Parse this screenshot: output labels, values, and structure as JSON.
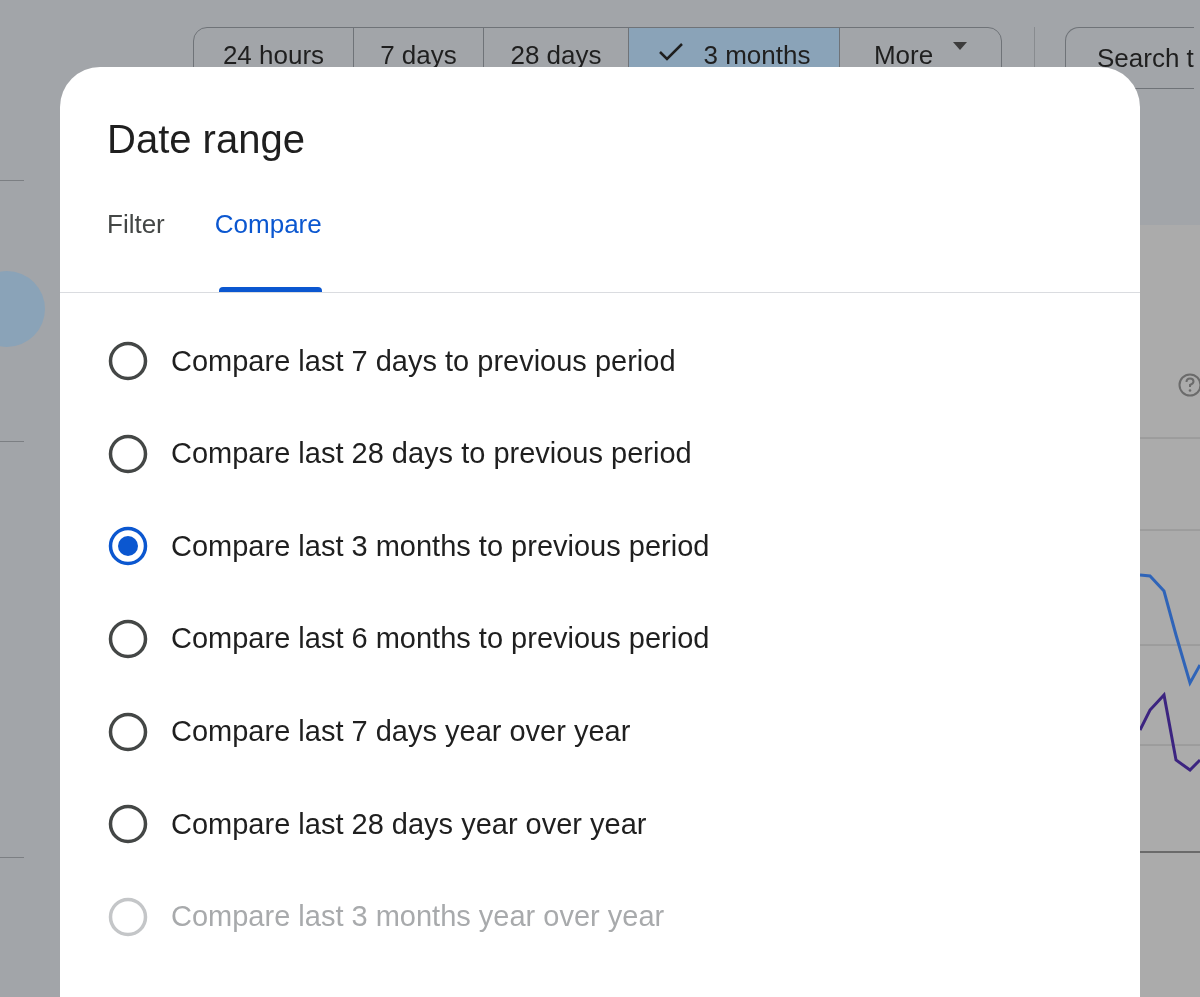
{
  "filter_bar": {
    "buttons": [
      {
        "kind": "range",
        "label": "24 hours",
        "selected": false
      },
      {
        "kind": "range",
        "label": "7 days",
        "selected": false
      },
      {
        "kind": "range",
        "label": "28 days",
        "selected": false
      },
      {
        "kind": "range",
        "label": "3 months",
        "selected": true
      },
      {
        "kind": "menu",
        "label": "More",
        "selected": false
      }
    ],
    "search": {
      "label": "Search t"
    }
  },
  "dialog": {
    "title": "Date range",
    "tabs": [
      {
        "label": "Filter",
        "selected": false
      },
      {
        "label": "Compare",
        "selected": true
      }
    ],
    "options": [
      {
        "label": "Compare last 7 days to previous period",
        "selected": false,
        "disabled": false
      },
      {
        "label": "Compare last 28 days to previous period",
        "selected": false,
        "disabled": false
      },
      {
        "label": "Compare last 3 months to previous period",
        "selected": true,
        "disabled": false
      },
      {
        "label": "Compare last 6 months to previous period",
        "selected": false,
        "disabled": false
      },
      {
        "label": "Compare last 7 days year over year",
        "selected": false,
        "disabled": false
      },
      {
        "label": "Compare last 28 days year over year",
        "selected": false,
        "disabled": false
      },
      {
        "label": "Compare last 3 months year over year",
        "selected": false,
        "disabled": true
      }
    ]
  }
}
